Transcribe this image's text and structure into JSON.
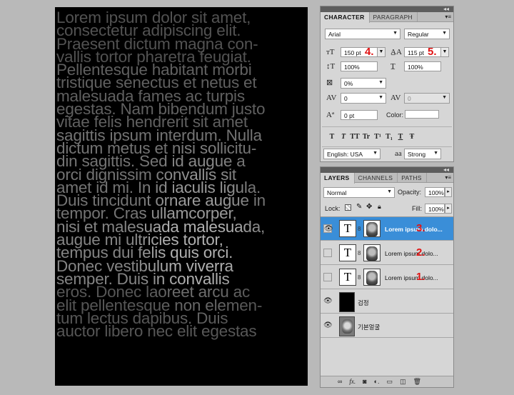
{
  "canvas": {
    "lines": [
      "Lorem ipsum dolor sit amet,",
      "consectetur adipiscing elit.",
      "Praesent dictum magna con-",
      "vallis tortor pharetra feugiat.",
      "Pellentesque habitant morbi",
      "tristique senectus et netus et",
      "malesuada fames ac turpis",
      "egestas. Nam bibendum justo",
      "vitae felis hendrerit sit amet",
      "sagittis ipsum interdum. Nulla",
      "dictum metus et nisi sollicitu-",
      "din sagittis. Sed id augue a",
      "orci dignissim convallis sit",
      "amet id mi. In id iaculis ligula.",
      "Duis tincidunt ornare augue in",
      "tempor. Cras ullamcorper,",
      "nisi et malesuada malesuada,",
      "augue mi ultricies tortor,",
      "tempus dui felis quis orci.",
      "Donec vestibulum viverra",
      "semper. Duis in convallis",
      "eros. Donec laoreet arcu ac",
      "elit pellentesque non elemen-",
      "tum lectus dapibus. Duis",
      "auctor libero nec elit egestas"
    ]
  },
  "character_panel": {
    "tabs": [
      "CHARACTER",
      "PARAGRAPH"
    ],
    "font_family": "Arial",
    "font_style": "Regular",
    "font_size": "150 pt",
    "leading": "115 pt",
    "vertical_scale": "100%",
    "horizontal_scale": "100%",
    "tsume": "0%",
    "kerning": "0",
    "tracking": "0",
    "baseline_shift": "0 pt",
    "color_label": "Color:",
    "language": "English: USA",
    "antialias_icon": "aa",
    "antialias": "Strong",
    "style_buttons": [
      "T",
      "T",
      "TT",
      "Tr",
      "T¹",
      "T₁",
      "T",
      "Ŧ"
    ],
    "annotation_size": "4.",
    "annotation_leading": "5."
  },
  "layers_panel": {
    "tabs": [
      "LAYERS",
      "CHANNELS",
      "PATHS"
    ],
    "blend_mode": "Normal",
    "opacity_label": "Opacity:",
    "opacity": "100%",
    "lock_label": "Lock:",
    "fill_label": "Fill:",
    "fill": "100%",
    "layers": [
      {
        "name": "Lorem ipsum dolo...",
        "annotation": "3.",
        "visible": true,
        "selected": true
      },
      {
        "name": "Lorem ipsum dolo...",
        "annotation": "2.",
        "visible": false,
        "selected": false
      },
      {
        "name": "Lorem ipsum dolo...",
        "annotation": "1.",
        "visible": false,
        "selected": false
      },
      {
        "name": "검정",
        "visible": true,
        "selected": false
      },
      {
        "name": "기본얼굴",
        "visible": true,
        "selected": false
      }
    ],
    "footer_icons": [
      "link-icon",
      "fx-icon",
      "mask-icon",
      "adjustment-icon",
      "folder-icon",
      "new-layer-icon",
      "trash-icon"
    ]
  },
  "colors": {
    "selection": "#3a8ed8",
    "annotation_red": "#e01414",
    "canvas_bg": "#000000"
  }
}
